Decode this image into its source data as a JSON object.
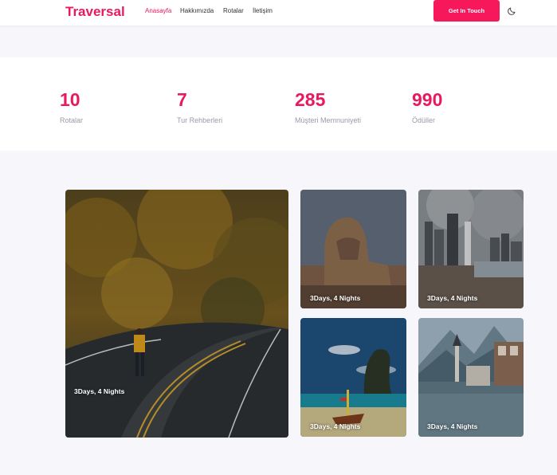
{
  "brand": "Traversal",
  "nav": {
    "items": [
      "Anasayfa",
      "Hakkımızda",
      "Rotalar",
      "İletişim"
    ],
    "cta_label": "Get In Touch"
  },
  "stats": [
    {
      "value": "10",
      "label": "Rotalar"
    },
    {
      "value": "7",
      "label": "Tur Rehberleri"
    },
    {
      "value": "285",
      "label": "Müşteri Memnuniyeti"
    },
    {
      "value": "990",
      "label": "Ödüller"
    }
  ],
  "tours": [
    {
      "label": "3Days, 4 Nights"
    },
    {
      "label": "3Days, 4 Nights"
    },
    {
      "label": "3Days, 4 Nights"
    },
    {
      "label": "3Days, 4 Nights"
    },
    {
      "label": "3Days, 4 Nights"
    }
  ],
  "colors": {
    "accent": "#e8195f",
    "cta": "#f6185b",
    "page_bg": "#f6f6fb"
  },
  "icons": {
    "theme_toggle": "moon-icon"
  }
}
